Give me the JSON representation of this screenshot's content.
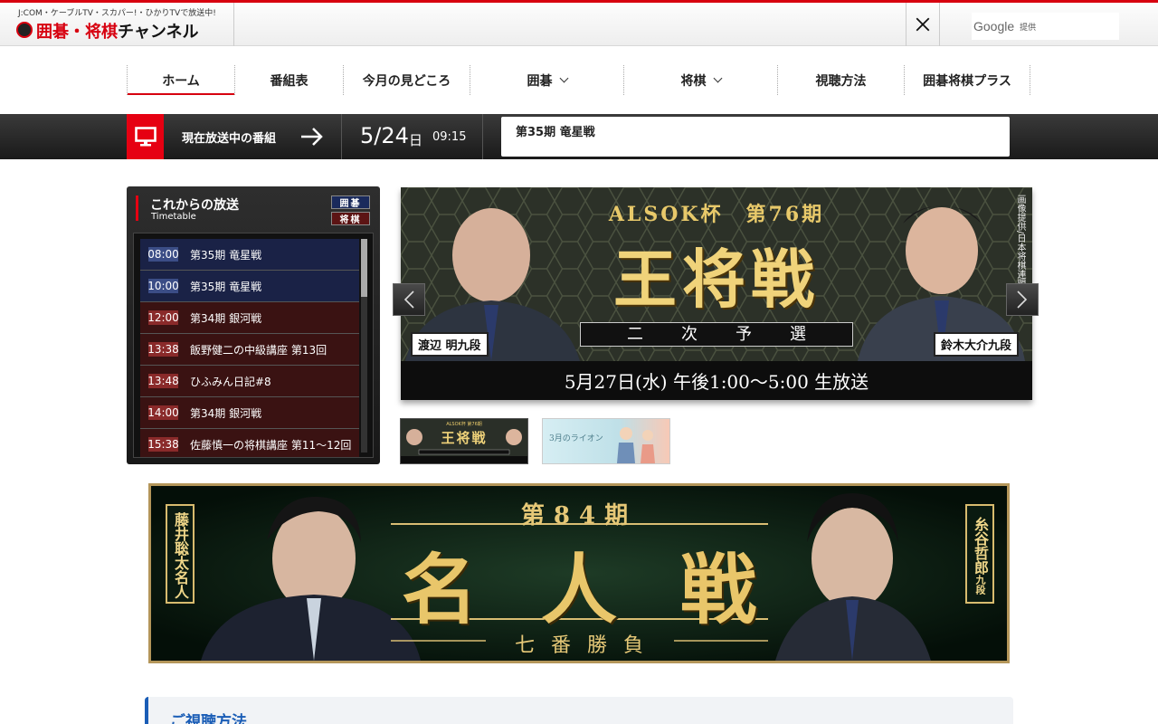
{
  "header": {
    "tagline": "J:COM・ケーブルTV・スカパー!・ひかりTVで放送中!",
    "logo_part1": "囲碁・将棋",
    "logo_part2": "チャンネル",
    "search_brand": "Google",
    "search_suffix": "提供"
  },
  "nav": {
    "items": [
      {
        "label": "ホーム"
      },
      {
        "label": "番組表"
      },
      {
        "label": "今月の見どころ"
      },
      {
        "label": "囲碁"
      },
      {
        "label": "将棋"
      },
      {
        "label": "視聴方法"
      },
      {
        "label": "囲碁将棋プラス"
      }
    ]
  },
  "onair": {
    "label": "現在放送中の番組",
    "date": "5/24",
    "day": "日",
    "time": "09:15",
    "program": "第35期 竜星戦"
  },
  "timetable": {
    "title": "これからの放送",
    "subtitle": "Timetable",
    "filter_igo": "囲碁",
    "filter_shogi": "将棋",
    "rows": [
      {
        "time": "08:00",
        "program": "第35期 竜星戦",
        "kind": "igo"
      },
      {
        "time": "10:00",
        "program": "第35期 竜星戦",
        "kind": "igo"
      },
      {
        "time": "12:00",
        "program": "第34期 銀河戦",
        "kind": "shogi"
      },
      {
        "time": "13:38",
        "program": "飯野健二の中級講座 第13回",
        "kind": "shogi"
      },
      {
        "time": "13:48",
        "program": "ひふみん日記#8",
        "kind": "shogi"
      },
      {
        "time": "14:00",
        "program": "第34期 銀河戦",
        "kind": "shogi"
      },
      {
        "time": "15:38",
        "program": "佐藤慎一の将棋講座 第11～12回",
        "kind": "shogi"
      }
    ]
  },
  "slider": {
    "cup": "ALSOK杯　第76期",
    "title": "王将戦",
    "stage": "二次予選",
    "date_line": "5月27日(水) 午後1:00～5:00 生放送",
    "player_left": "渡辺 明九段",
    "player_right": "鈴木大介九段",
    "credit": "画像提供/日本将棋連盟"
  },
  "thumbs": {
    "t1_cup": "ALSOK杯 第76期",
    "t1_title": "王将戦",
    "t2_title": "3月のライオン"
  },
  "meijin": {
    "term": "第84期",
    "title": "名人戦",
    "subtitle": "七番勝負",
    "player_left": "藤井聡太名人",
    "player_right_name": "糸谷哲郎",
    "player_right_rank": "九段"
  },
  "section": {
    "title": "ご視聴方法"
  },
  "colors": {
    "accent_red": "#d7000f",
    "igo_blue": "#1a2246",
    "shogi_red": "#3a1212",
    "section_blue": "#1a5db6"
  }
}
